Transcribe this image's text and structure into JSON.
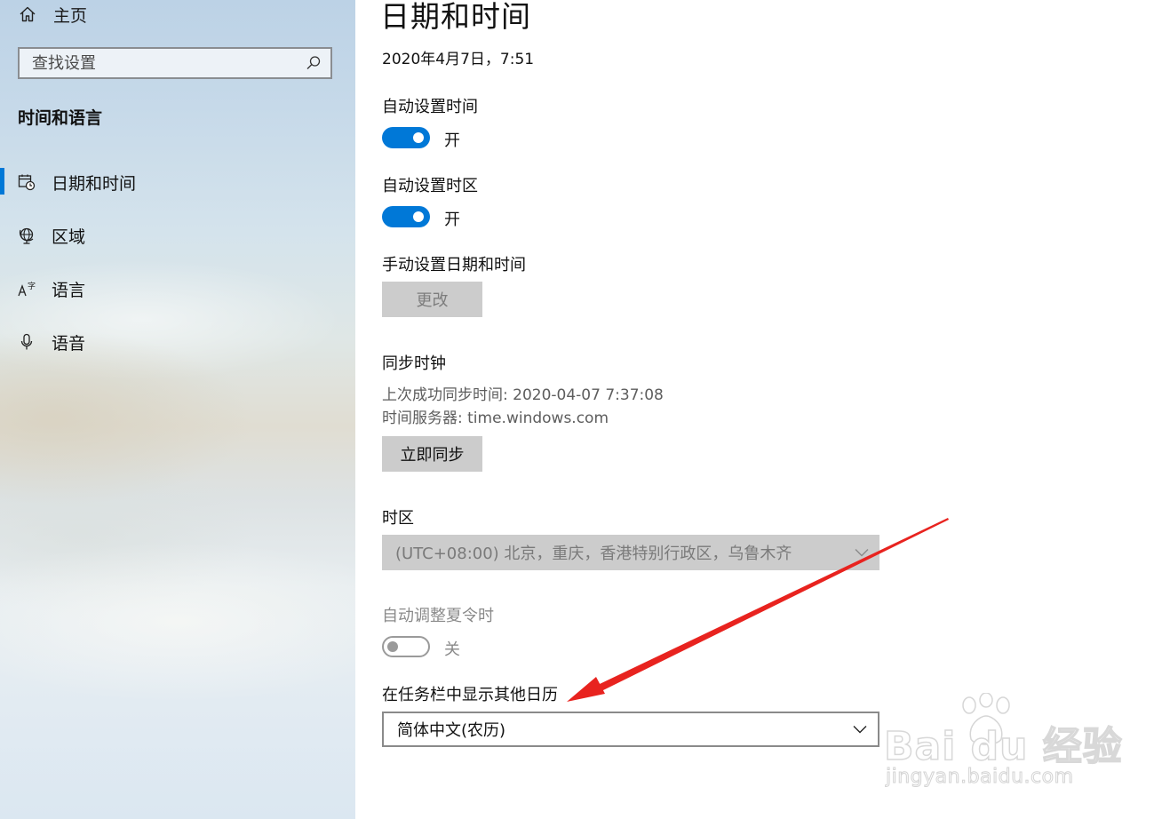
{
  "sidebar": {
    "home_label": "主页",
    "search_placeholder": "查找设置",
    "section_title": "时间和语言",
    "accent_color": "#0078d7",
    "items": [
      {
        "label": "日期和时间",
        "icon": "calendar-clock-icon",
        "selected": true
      },
      {
        "label": "区域",
        "icon": "globe-icon",
        "selected": false
      },
      {
        "label": "语言",
        "icon": "language-icon",
        "selected": false
      },
      {
        "label": "语音",
        "icon": "microphone-icon",
        "selected": false
      }
    ]
  },
  "main": {
    "title": "日期和时间",
    "current_datetime": "2020年4月7日，7:51",
    "auto_time": {
      "label": "自动设置时间",
      "state_text": "开",
      "on": true
    },
    "auto_timezone": {
      "label": "自动设置时区",
      "state_text": "开",
      "on": true
    },
    "manual": {
      "label": "手动设置日期和时间",
      "button_label": "更改",
      "enabled": false
    },
    "sync": {
      "label": "同步时钟",
      "last_sync": "上次成功同步时间: 2020-04-07 7:37:08",
      "server": "时间服务器: time.windows.com",
      "button_label": "立即同步"
    },
    "timezone": {
      "label": "时区",
      "value": "(UTC+08:00) 北京，重庆，香港特别行政区，乌鲁木齐",
      "enabled": false
    },
    "dst": {
      "label": "自动调整夏令时",
      "state_text": "关",
      "on": false,
      "enabled": false
    },
    "calendar": {
      "label": "在任务栏中显示其他日历",
      "value": "简体中文(农历)"
    }
  },
  "annotation": {
    "arrow_color": "#e8231f"
  },
  "watermark": {
    "brand": "Bai du 经验",
    "url": "jingyan.baidu.com"
  }
}
